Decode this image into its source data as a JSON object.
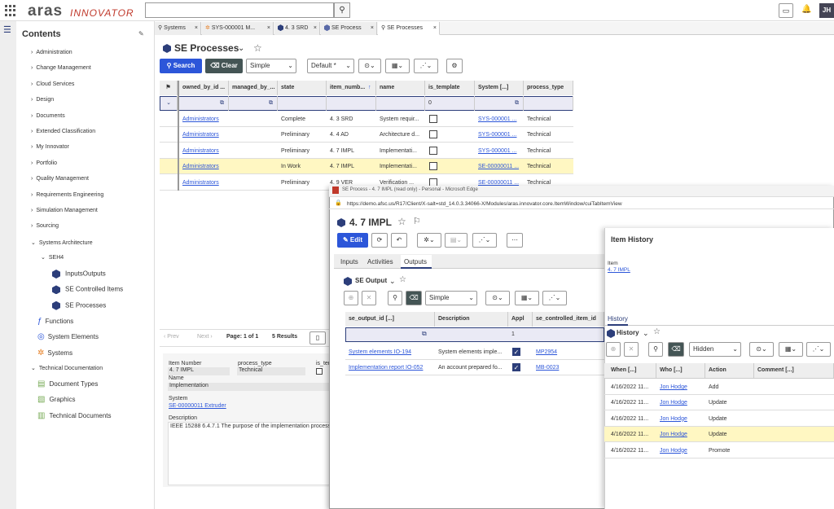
{
  "topbar": {
    "logo_aras": "aras",
    "logo_innovator": "INNOVATOR",
    "avatar": "JH"
  },
  "sidebar": {
    "title": "Contents",
    "items": [
      "Administration",
      "Change Management",
      "Cloud Services",
      "Design",
      "Documents",
      "Extended Classification",
      "My Innovator",
      "Portfolio",
      "Quality Management",
      "Requirements Engineering",
      "Simulation Management",
      "Sourcing",
      "Systems Architecture"
    ],
    "seh4": "SEH4",
    "seh4_children": [
      "InputsOutputs",
      "SE Controlled Items",
      "SE Processes"
    ],
    "sa_children": [
      "Functions",
      "System Elements",
      "Systems"
    ],
    "tech_doc": "Technical Documentation",
    "td_children": [
      "Document Types",
      "Graphics",
      "Technical Documents"
    ]
  },
  "tabs": [
    "Systems",
    "SYS-000001 M...",
    "4. 3 SRD",
    "SE Process",
    "SE Processes"
  ],
  "main": {
    "title": "SE Processes",
    "search_label": "Search",
    "clear_label": "Clear",
    "mode_select": "Simple",
    "default_select": "Default *",
    "columns": [
      "owned_by_id ...",
      "managed_by_...",
      "state",
      "item_numb...",
      "name",
      "is_template",
      "System [...]",
      "process_type"
    ],
    "filter_is_template": "0",
    "rows": [
      {
        "owned": "Administrators",
        "state": "Complete",
        "num": "4. 3 SRD",
        "name": "System requir...",
        "system": "SYS-000001 ...",
        "ptype": "Technical"
      },
      {
        "owned": "Administrators",
        "state": "Preliminary",
        "num": "4. 4 AD",
        "name": "Architecture d...",
        "system": "SYS-000001 ...",
        "ptype": "Technical"
      },
      {
        "owned": "Administrators",
        "state": "Preliminary",
        "num": "4. 7 IMPL",
        "name": "Implementati...",
        "system": "SYS-000001 ...",
        "ptype": "Technical"
      },
      {
        "owned": "Administrators",
        "state": "In Work",
        "num": "4. 7 IMPL",
        "name": "Implementati...",
        "system": "SE-00000011 ...",
        "ptype": "Technical"
      },
      {
        "owned": "Administrators",
        "state": "Preliminary",
        "num": "4. 9 VER",
        "name": "Verification ...",
        "system": "SE-00000011 ...",
        "ptype": "Technical"
      }
    ],
    "pager": {
      "prev": "Prev",
      "next": "Next",
      "page": "Page: 1 of 1",
      "results": "5 Results"
    },
    "preview": {
      "item_number_label": "Item Number",
      "item_number": "4. 7 IMPL",
      "process_type_label": "process_type",
      "process_type": "Technical",
      "is_template_label": "is_ter",
      "name_label": "Name",
      "name": "Implementation",
      "system_label": "System",
      "system": "SE-00000011 Extruder",
      "description_label": "Description",
      "description": "IEEE 15288 6.4.7.1 The purpose of the implementation process is to"
    }
  },
  "popup": {
    "window_title": "SE Process - 4. 7 IMPL (read only) - Personal - Microsoft Edge",
    "url": "https://demo.afsc.us/R17/Client/X-salt=std_14.0.3.34066-X/Modules/aras.innovator.core.ItemWindow/cuiTabItemView",
    "title": "4. 7 IMPL",
    "edit_label": "Edit",
    "subtabs": [
      "Inputs",
      "Activities",
      "Outputs"
    ],
    "output_title": "SE Output",
    "mode_select": "Simple",
    "columns": [
      "se_output_id [...]",
      "Description",
      "Appl",
      "se_controlled_item_id [...]"
    ],
    "filter_appl": "1",
    "rows": [
      {
        "id": "System elements IO-194",
        "desc": "System elements imple...",
        "item": "MP2954"
      },
      {
        "id": "Implementation report IO-052",
        "desc": "An account prepared fo...",
        "item": "MB-0023"
      }
    ]
  },
  "history": {
    "title": "Item History",
    "item_label": "Item",
    "item_value": "4. 7 IMPL",
    "tab": "History",
    "sub_title": "History",
    "select": "Hidden",
    "columns": [
      "When [...]",
      "Who [...]",
      "Action",
      "Comment [...]"
    ],
    "rows": [
      {
        "when": "4/16/2022 11...",
        "who": "Jon Hodge",
        "action": "Add"
      },
      {
        "when": "4/16/2022 11...",
        "who": "Jon Hodge",
        "action": "Update"
      },
      {
        "when": "4/16/2022 11...",
        "who": "Jon Hodge",
        "action": "Update"
      },
      {
        "when": "4/16/2022 11...",
        "who": "Jon Hodge",
        "action": "Update"
      },
      {
        "when": "4/16/2022 11...",
        "who": "Jon Hodge",
        "action": "Promote"
      }
    ]
  }
}
